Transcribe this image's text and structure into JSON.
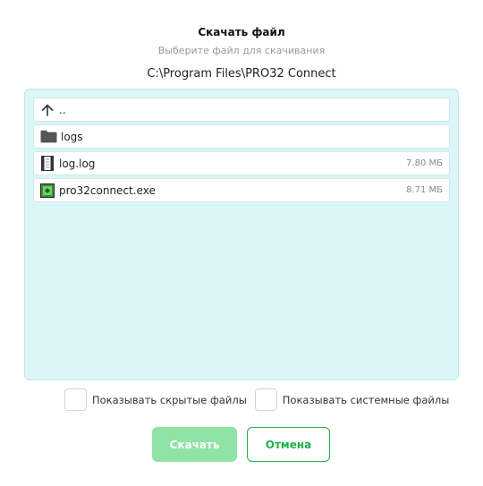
{
  "dialog": {
    "title": "Скачать файл",
    "subtitle": "Выберите файл для скачивания",
    "current_path": "C:\\Program Files\\PRO32 Connect"
  },
  "files": [
    {
      "icon": "arrow-up-icon",
      "name": "..",
      "size": ""
    },
    {
      "icon": "folder-icon",
      "name": "logs",
      "size": ""
    },
    {
      "icon": "file-log-icon",
      "name": "log.log",
      "size": "7.80 МБ"
    },
    {
      "icon": "exe-app-icon",
      "name": "pro32connect.exe",
      "size": "8.71 МБ"
    }
  ],
  "options": {
    "show_hidden": {
      "label": "Показывать скрытые файлы",
      "checked": false
    },
    "show_system": {
      "label": "Показывать системные файлы",
      "checked": false
    }
  },
  "buttons": {
    "download": "Скачать",
    "cancel": "Отмена"
  },
  "colors": {
    "panel_bg": "#dcf5f7",
    "accent_green": "#22b14c",
    "download_disabled": "#8fe3a4"
  }
}
